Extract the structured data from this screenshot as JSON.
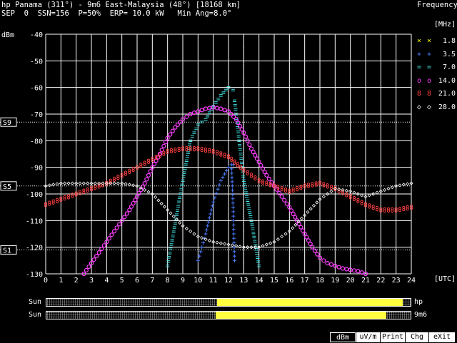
{
  "header": {
    "line1": "hp Panama (311°) - 9m6 East-Malaysia (48°) [18168 km]",
    "line2": "SEP  0  SSN=156  P=50%  ERP= 10.0 kW   Min Ang=8.0°",
    "frequency_title": "Frequency",
    "mhz_unit": "[MHz]",
    "utc_unit": "[UTC]"
  },
  "axis": {
    "y_unit": "dBm",
    "y_ticks": [
      "-40",
      "-50",
      "-60",
      "-70",
      "-80",
      "-90",
      "-100",
      "-110",
      "-120",
      "-130"
    ],
    "x_ticks": [
      "0",
      "1",
      "2",
      "3",
      "4",
      "5",
      "6",
      "7",
      "8",
      "9",
      "10",
      "11",
      "12",
      "13",
      "14",
      "15",
      "16",
      "17",
      "18",
      "19",
      "20",
      "21",
      "22",
      "23",
      "24"
    ],
    "s_labels": [
      {
        "label": "S9",
        "dbm": -73
      },
      {
        "label": "S5",
        "dbm": -97
      },
      {
        "label": "S1",
        "dbm": -121
      }
    ],
    "current_hour": 13
  },
  "legend": [
    {
      "symbol": "× ×",
      "value": "1.8",
      "color": "#ffff00"
    },
    {
      "symbol": "+ +",
      "value": "3.5",
      "color": "#4a7dff"
    },
    {
      "symbol": "= =",
      "value": "7.0",
      "color": "#40e0e0"
    },
    {
      "symbol": "o o",
      "value": "14.0",
      "color": "#ff40ff"
    },
    {
      "symbol": "8 8",
      "value": "21.0",
      "color": "#ff4040"
    },
    {
      "symbol": "◇ ◇",
      "value": "28.0",
      "color": "#ffffff"
    }
  ],
  "chart_data": {
    "type": "scatter",
    "x_unit": "UTC hour",
    "y_unit": "dBm",
    "xlim": [
      0,
      24
    ],
    "ylim": [
      -130,
      -40
    ],
    "grid": true,
    "series": [
      {
        "name": "3.5",
        "color": "#4a7dff",
        "marker": "+",
        "x": [
          10,
          10.5,
          11,
          11.5,
          12,
          12.3
        ],
        "y": [
          -125,
          -115,
          -103,
          -95,
          -90,
          -89
        ]
      },
      {
        "name": "3.5",
        "color": "#4a7dff",
        "marker": "+",
        "x": [
          12.2,
          12.3,
          12.4
        ],
        "y": [
          -89,
          -105,
          -125
        ]
      },
      {
        "name": "7.0",
        "color": "#40e0e0",
        "marker": "=",
        "x": [
          8,
          8.5,
          9,
          9.5,
          10,
          10.5,
          11,
          11.5,
          12,
          12.3
        ],
        "y": [
          -127,
          -111,
          -95,
          -80,
          -74,
          -72,
          -67,
          -63,
          -60,
          -61
        ]
      },
      {
        "name": "7.0",
        "color": "#40e0e0",
        "marker": "=",
        "x": [
          12.4,
          12.7,
          13,
          13.5,
          14
        ],
        "y": [
          -65,
          -80,
          -95,
          -110,
          -127
        ]
      },
      {
        "name": "14.0",
        "color": "#ff40ff",
        "marker": "o",
        "x": [
          2.5,
          3,
          3.5,
          4,
          4.5,
          5,
          5.5,
          6,
          6.5,
          7,
          7.5,
          8,
          8.5,
          9,
          9.5,
          10,
          10.5,
          11,
          11.5,
          12,
          12.5,
          13,
          13.5,
          14,
          14.5,
          15,
          15.5,
          16,
          16.5,
          17,
          17.5,
          18,
          18.5,
          19,
          19.5,
          20,
          20.5,
          21
        ],
        "y": [
          -130,
          -126,
          -122,
          -118,
          -114,
          -110,
          -106,
          -101,
          -96,
          -90,
          -85,
          -79,
          -75,
          -72,
          -70,
          -69,
          -68,
          -67.5,
          -68,
          -69,
          -72,
          -77,
          -83,
          -88,
          -93,
          -97,
          -101,
          -105,
          -110,
          -115,
          -120,
          -124,
          -126,
          -127,
          -128,
          -128.5,
          -129,
          -130
        ]
      },
      {
        "name": "21.0",
        "color": "#ff4040",
        "marker": "8",
        "x": [
          0,
          1,
          2,
          3,
          4,
          5,
          6,
          7,
          8,
          9,
          10,
          11,
          12,
          13,
          14,
          15,
          16,
          17,
          18,
          19,
          20,
          21,
          22,
          23,
          24
        ],
        "y": [
          -104,
          -102,
          -100,
          -98,
          -96,
          -93,
          -90,
          -87,
          -84,
          -83,
          -83,
          -84,
          -86,
          -91,
          -95,
          -97,
          -99,
          -97,
          -96,
          -98,
          -101,
          -104,
          -106,
          -106,
          -105
        ]
      },
      {
        "name": "28.0",
        "color": "#ffffff",
        "marker": "◇",
        "x": [
          0,
          1,
          2,
          3,
          4,
          5,
          6,
          7,
          8,
          9,
          10,
          11,
          12,
          13,
          14,
          15,
          16,
          17,
          18,
          19,
          20,
          21,
          22,
          23,
          24
        ],
        "y": [
          -97,
          -96,
          -96,
          -96,
          -96,
          -96,
          -97,
          -100,
          -106,
          -112,
          -116,
          -118,
          -119,
          -120,
          -120,
          -118,
          -114,
          -108,
          -102,
          -98,
          -99,
          -101,
          -99,
          -97,
          -96
        ]
      }
    ]
  },
  "daylight": {
    "rows": [
      {
        "label": "Sun",
        "station": "hp",
        "dark_start": 0,
        "dark_end": 11.3,
        "dark2_start": 23.4,
        "dark2_end": 24
      },
      {
        "label": "Sun",
        "station": "9m6",
        "dark_start": 0,
        "dark_end": 11.2,
        "dark2_start": 22.3,
        "dark2_end": 24
      }
    ]
  },
  "buttons": [
    {
      "label": "dBm",
      "selected": true
    },
    {
      "label": "uV/m",
      "selected": false
    },
    {
      "label": "Print",
      "selected": false
    },
    {
      "label": "Chg",
      "selected": false
    },
    {
      "label": "eXit",
      "selected": false
    }
  ]
}
